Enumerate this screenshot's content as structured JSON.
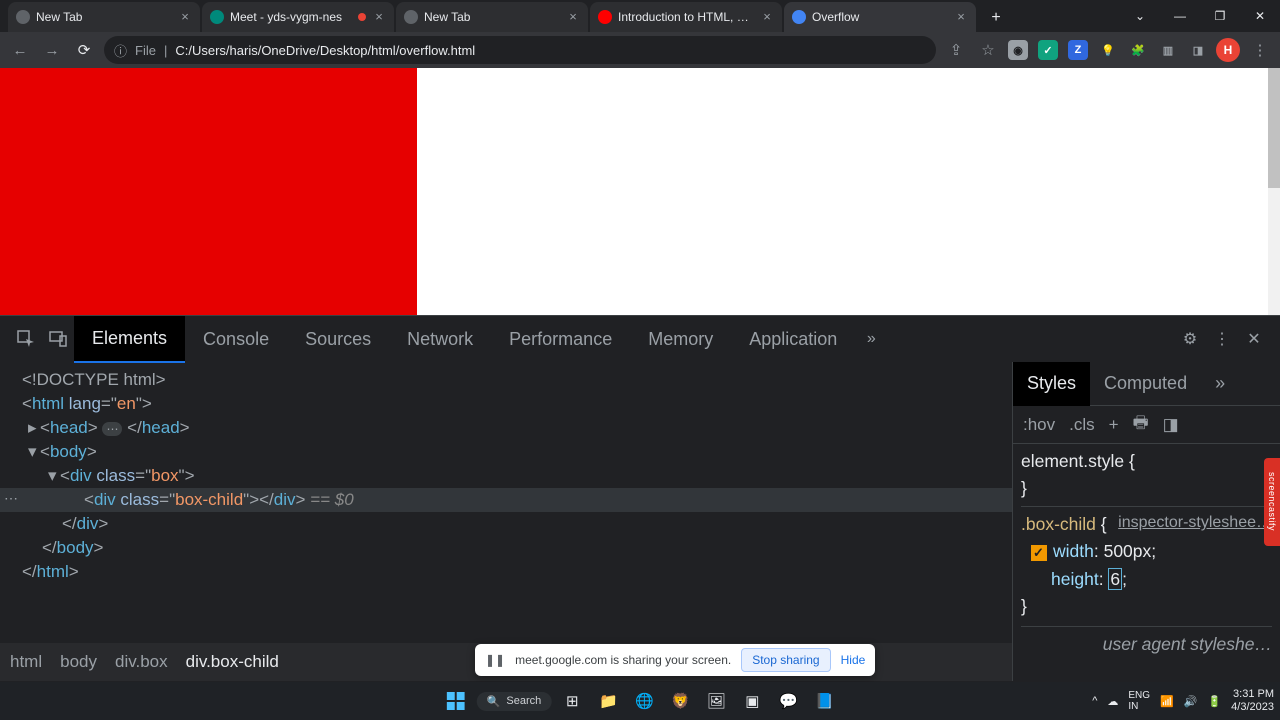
{
  "tabs": [
    {
      "title": "New Tab",
      "favicon_bg": "#5f6368"
    },
    {
      "title": "Meet - yds-vygm-nes",
      "favicon_bg": "#00897b",
      "recording": true
    },
    {
      "title": "New Tab",
      "favicon_bg": "#5f6368"
    },
    {
      "title": "Introduction to HTML, CSS, JavaS",
      "favicon_bg": "#ff0000"
    },
    {
      "title": "Overflow",
      "favicon_bg": "#4285f4",
      "active": true
    }
  ],
  "addr": {
    "prefix": "File",
    "sep": "|",
    "url": "C:/Users/haris/OneDrive/Desktop/html/overflow.html"
  },
  "avatar": "H",
  "devtools": {
    "tabs": [
      "Elements",
      "Console",
      "Sources",
      "Network",
      "Performance",
      "Memory",
      "Application"
    ],
    "active_tab": "Elements",
    "dom": {
      "l0": "<!DOCTYPE html>",
      "html_open1": "<",
      "html_open2": "html ",
      "html_attr": "lang",
      "html_eq": "=\"",
      "html_val": "en",
      "html_close": "\">",
      "head": "<head>",
      "head_end": "</head>",
      "body": "<body>",
      "box_open": "<div class=\"box\">",
      "child": "<div class=\"box-child\"></div>",
      "eq0": " == $0",
      "box_close": "</div>",
      "body_close": "</body>",
      "html_close_tag": "</html>"
    },
    "crumbs": [
      "html",
      "body",
      "div.box",
      "div.box-child"
    ]
  },
  "styles": {
    "tabs": [
      "Styles",
      "Computed"
    ],
    "active": "Styles",
    "toolbar": {
      "hov": ":hov",
      "cls": ".cls"
    },
    "element_style": "element.style {",
    "close_brace": "}",
    "sheet_link": "inspector-styleshee…",
    "selector": ".box-child {",
    "prop1": "width",
    "val1": "500px",
    "prop2": "height",
    "val2": "6",
    "ua": "user agent styleshe…"
  },
  "share_bar": {
    "text": "meet.google.com is sharing your screen.",
    "stop": "Stop sharing",
    "hide": "Hide"
  },
  "taskbar": {
    "search": "Search",
    "time": "3:31 PM",
    "date": "4/3/2023"
  },
  "sidetag": "screencastify"
}
